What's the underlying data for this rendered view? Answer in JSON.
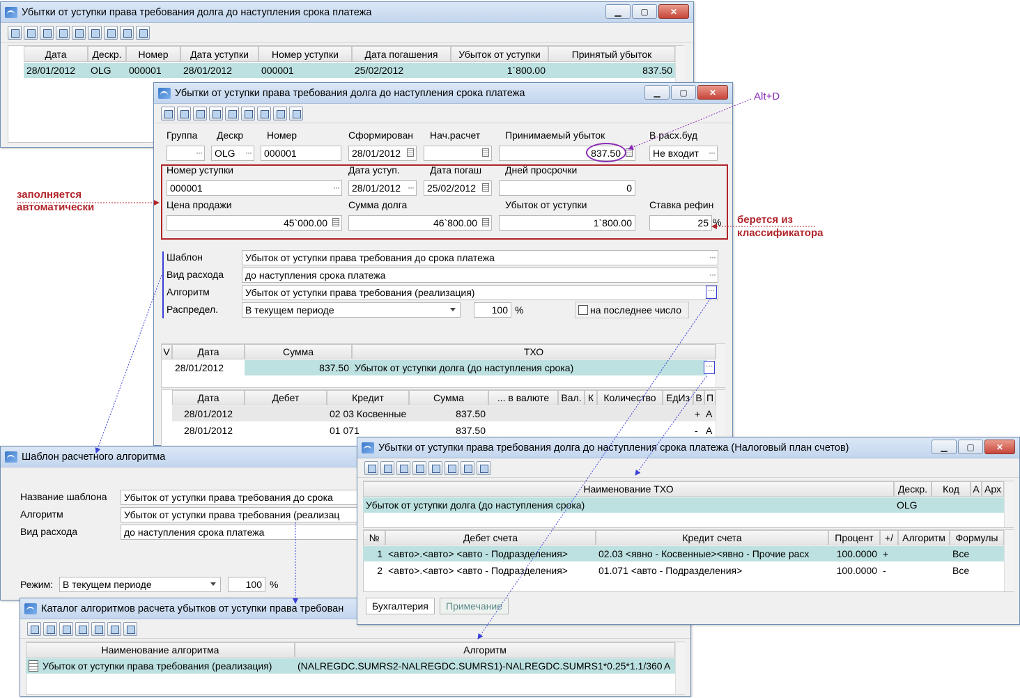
{
  "w1": {
    "title": "Убытки от уступки права требования долга до наступления срока платежа",
    "columns": [
      "Дата",
      "Дескр.",
      "Номер",
      "Дата уступки",
      "Номер уступки",
      "Дата погашения",
      "Убыток от уступки",
      "Принятый убыток"
    ],
    "row": [
      "28/01/2012",
      "OLG",
      "000001",
      "28/01/2012",
      "000001",
      "25/02/2012",
      "1`800.00",
      "837.50"
    ]
  },
  "w2": {
    "title": "Убытки от уступки права требования долга до наступления срока платежа",
    "labels": {
      "group": "Группа",
      "descr": "Дескр",
      "number": "Номер",
      "formed": "Сформирован",
      "calc_start": "Нач.расчет",
      "accepted_loss": "Принимаемый убыток",
      "future": "В расх.буд",
      "assign_no": "Номер уступки",
      "assign_date": "Дата уступ.",
      "repay_date": "Дата погаш",
      "overdue": "Дней просрочки",
      "sale_price": "Цена продажи",
      "debt_sum": "Сумма долга",
      "assign_loss": "Убыток от уступки",
      "refin_rate": "Ставка рефин",
      "template": "Шаблон",
      "expense_type": "Вид расхода",
      "algorithm": "Алгоритм",
      "distrib": "Распредел.",
      "percent": "%",
      "last_day": "на последнее число"
    },
    "values": {
      "group": "",
      "descr": "OLG",
      "number": "000001",
      "formed": "28/01/2012",
      "calc_start": "",
      "accepted_loss": "837.50",
      "future": "Не входит",
      "assign_no": "000001",
      "assign_date": "28/01/2012",
      "repay_date": "25/02/2012",
      "overdue": "0",
      "sale_price": "45`000.00",
      "debt_sum": "46`800.00",
      "assign_loss": "1`800.00",
      "refin_rate": "25",
      "refin_pct": "%",
      "template": "Убыток от уступки права требования до срока платежа",
      "expense_type": "до наступления срока платежа",
      "algorithm": "Убыток от уступки права требования (реализация)",
      "distrib": "В текущем периоде",
      "distrib_pct": "100"
    },
    "txo_columns": [
      "V",
      "Дата",
      "Сумма",
      "ТХО"
    ],
    "txo_row": [
      "28/01/2012",
      "837.50",
      "Убыток от уступки долга (до наступления срока)"
    ],
    "post_columns": [
      "Дата",
      "Дебет",
      "Кредит",
      "Сумма",
      "... в валюте",
      "Вал.",
      "К",
      "Количество",
      "ЕдИз",
      "В",
      "П"
    ],
    "post_rows": [
      [
        "28/01/2012",
        "",
        "02 03 Косвенные",
        "837.50",
        "+",
        "А"
      ],
      [
        "28/01/2012",
        "",
        "01 071",
        "837.50",
        "-",
        "А"
      ]
    ]
  },
  "w3": {
    "title": "Шаблон расчетного алгоритма",
    "labels": {
      "name": "Название шаблона",
      "algo": "Алгоритм",
      "exp": "Вид расхода",
      "mode": "Режим:",
      "pct": "%"
    },
    "values": {
      "name": "Убыток от уступки права требования до срока",
      "algo": "Убыток от уступки права требования (реализац",
      "exp": "до наступления срока платежа",
      "mode": "В текущем периоде",
      "pct_val": "100"
    }
  },
  "w4": {
    "title": "Каталог алгоритмов расчета убытков от уступки права требован",
    "columns": [
      "Наименование алгоритма",
      "Алгоритм"
    ],
    "row": [
      "Убыток от уступки права требования (реализация)",
      "(NALREGDC.SUMRS2-NALREGDC.SUMRS1)-NALREGDC.SUMRS1*0.25*1.1/360*",
      "A"
    ]
  },
  "w5": {
    "title": "Убытки от уступки права требования долга до наступления срока платежа (Налоговый план счетов)",
    "top_columns": [
      "Наименование ТХО",
      "Дескр.",
      "Код",
      "А",
      "Арх"
    ],
    "top_row": [
      "Убыток от уступки долга (до наступления срока)",
      "OLG"
    ],
    "columns": [
      "№",
      "Дебет счета",
      "Кредит счета",
      "Процент",
      "+/",
      "Алгоритм",
      "Формулы"
    ],
    "rows": [
      [
        "1",
        "<авто>.<авто> <авто - Подразделения>",
        "02.03 <явно - Косвенные><явно - Прочие расх",
        "100.0000",
        "+",
        "",
        "Все"
      ],
      [
        "2",
        "<авто>.<авто> <авто - Подразделения>",
        "01.071 <авто - Подразделения>",
        "100.0000",
        "-",
        "",
        "Все"
      ]
    ],
    "tabs": [
      "Бухгалтерия",
      "Примечание"
    ]
  },
  "annotations": {
    "auto_fill": "заполняется\nавтоматически",
    "auto_fill_1": "заполняется",
    "auto_fill_2": "автоматически",
    "from_class_1": "берется из",
    "from_class_2": "классификатора",
    "hotkey": "Alt+D"
  },
  "colors": {
    "selected_row": "#bde1e0",
    "annotation_red": "#b0242a",
    "annotation_purple": "#8a2bb5",
    "arrow_blue": "#3a40d8"
  }
}
